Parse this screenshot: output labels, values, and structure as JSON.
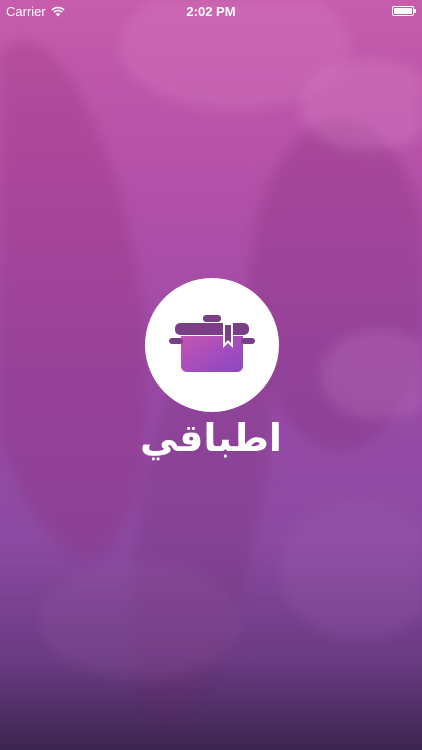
{
  "status_bar": {
    "carrier": "Carrier",
    "time": "2:02 PM",
    "battery_level": 1.0
  },
  "splash": {
    "app_name": "اطباقي",
    "logo_icon": "cooking-pot-bookmark-icon"
  },
  "colors": {
    "accent_top": "#c65cab",
    "accent_bottom": "#6a3a82",
    "logo_background": "#ffffff",
    "logo_gradient_start": "#c456b3",
    "logo_gradient_end": "#8a46c4"
  }
}
